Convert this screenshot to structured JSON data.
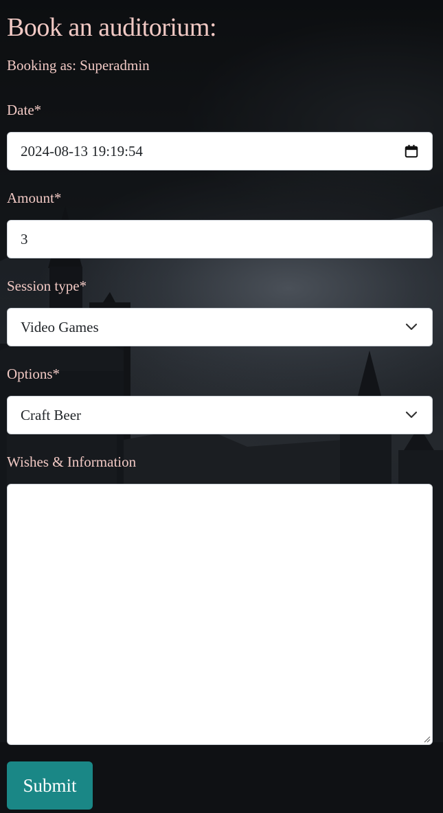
{
  "page": {
    "title": "Book an auditorium:",
    "booking_as": "Booking as: Superadmin"
  },
  "form": {
    "date": {
      "label": "Date*",
      "value": "2024-08-13 19:19:54",
      "icon": "calendar-icon"
    },
    "amount": {
      "label": "Amount*",
      "value": "3"
    },
    "session_type": {
      "label": "Session type*",
      "value": "Video Games",
      "icon": "chevron-down-icon"
    },
    "options": {
      "label": "Options*",
      "value": "Craft Beer",
      "icon": "chevron-down-icon"
    },
    "wishes": {
      "label": "Wishes & Information",
      "value": ""
    },
    "submit_label": "Submit"
  },
  "colors": {
    "label_text": "#f1c9c4",
    "submit_bg": "#1a8786",
    "field_bg": "#ffffff"
  }
}
